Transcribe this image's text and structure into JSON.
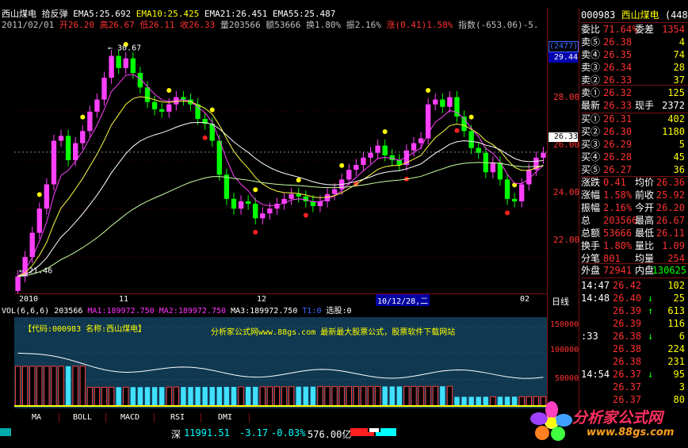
{
  "header": {
    "stock_name": "西山煤电",
    "indicator": "拾反弹",
    "ema5": "EMA5:25.692",
    "ema10": "EMA10:25.425",
    "ema21": "EMA21:26.451",
    "ema55": "EMA55:25.487",
    "date": "2011/02/01",
    "open": "开26.20",
    "high": "高26.67",
    "low": "低26.11",
    "close": "收26.33",
    "volume": "量203566",
    "amount": "额53666",
    "turnover": "换1.80%",
    "amplitude": "振2.16%",
    "change": "涨(0.41)1.58%",
    "index": "指数(-653.06)-5."
  },
  "chart_labels": {
    "high_mark": "30.67",
    "low_mark": "21.46",
    "count_box": "(2477)",
    "top_price": "29.44",
    "y_ticks": [
      "28.00",
      "26.00",
      "24.00",
      "22.00"
    ],
    "current_price": "26.33",
    "x_labels": [
      "2010",
      "11",
      "12",
      "10/12/28,二",
      "02"
    ],
    "period": "日线"
  },
  "volume_header": {
    "vol": "VOL(6,6,6)",
    "vol_value": "203566",
    "ma1": "MA1:189972.750",
    "ma2": "MA2:189972.750",
    "ma3": "MA3:189972.750",
    "t1": "T1:0",
    "select": "选股:0",
    "code_line": "【代码:000983 名称:西山煤电】",
    "ad_line": "分析家公式网www.88gs.com 最新最大股票公式，股票软件下载网站",
    "y_ticks": [
      "150000",
      "100000",
      "50000"
    ]
  },
  "tabs": [
    "MA",
    "BOLL",
    "MACD",
    "RSI",
    "DMI"
  ],
  "status_bar": {
    "market": "深",
    "index_value": "11991.51",
    "change": "-3.17",
    "pct": "-0.03%",
    "amount": "576.00亿"
  },
  "right_panel": {
    "code": "000983",
    "name": "西山煤电",
    "extra": "(448",
    "weibi_label": "委比",
    "weibi": "71.64%",
    "weicha_label": "委差",
    "weicha": "1354",
    "asks": [
      {
        "label": "卖⑤",
        "price": "26.38",
        "vol": "4"
      },
      {
        "label": "卖④",
        "price": "26.35",
        "vol": "74"
      },
      {
        "label": "卖③",
        "price": "26.34",
        "vol": "28"
      },
      {
        "label": "卖②",
        "price": "26.33",
        "vol": "37"
      },
      {
        "label": "卖①",
        "price": "26.32",
        "vol": "125"
      }
    ],
    "last_label": "最新",
    "last": "26.33",
    "hand_label": "现手",
    "hand": "2372",
    "bids": [
      {
        "label": "买①",
        "price": "26.31",
        "vol": "402"
      },
      {
        "label": "买②",
        "price": "26.30",
        "vol": "1180"
      },
      {
        "label": "买③",
        "price": "26.29",
        "vol": "5"
      },
      {
        "label": "买④",
        "price": "26.28",
        "vol": "45"
      },
      {
        "label": "买⑤",
        "price": "26.27",
        "vol": "36"
      }
    ],
    "stats": [
      {
        "l1": "涨跌",
        "v1": "0.41",
        "l2": "均价",
        "v2": "26.36"
      },
      {
        "l1": "涨幅",
        "v1": "1.58%",
        "l2": "前收",
        "v2": "25.92"
      },
      {
        "l1": "振幅",
        "v1": "2.16%",
        "l2": "今开",
        "v2": "26.20"
      },
      {
        "l1": "总",
        "v1": "203566",
        "l2": "最高",
        "v2": "26.67"
      },
      {
        "l1": "总额",
        "v1": "53666",
        "l2": "最低",
        "v2": "26.11"
      },
      {
        "l1": "换手",
        "v1": "1.80%",
        "l2": "量比",
        "v2": "1.09"
      },
      {
        "l1": "分笔",
        "v1": "801",
        "l2": "均量",
        "v2": "254"
      }
    ],
    "outer_label": "外盘",
    "outer": "72941",
    "inner_label": "内盘",
    "inner": "130625",
    "ticks": [
      {
        "time": "14:47",
        "price": "26.42",
        "arrow": "",
        "vol": "102"
      },
      {
        "time": "14:48",
        "price": "26.40",
        "arrow": "↓",
        "vol": "25"
      },
      {
        "time": "",
        "price": "26.39",
        "arrow": "↑",
        "vol": "613"
      },
      {
        "time": "",
        "price": "26.39",
        "arrow": "",
        "vol": "116"
      },
      {
        "time": ":33",
        "price": "26.38",
        "arrow": "↓",
        "vol": "6"
      },
      {
        "time": "",
        "price": "26.38",
        "arrow": "",
        "vol": "224"
      },
      {
        "time": "",
        "price": "26.38",
        "arrow": "",
        "vol": "231"
      },
      {
        "time": "14:54",
        "price": "26.37",
        "arrow": "↓",
        "vol": "95"
      },
      {
        "time": "",
        "price": "26.37",
        "arrow": "",
        "vol": "3"
      },
      {
        "time": "",
        "price": "26.37",
        "arrow": "",
        "vol": "80"
      }
    ],
    "watermark": "分析家公式网",
    "watermark_url": "www.88gs.com"
  }
}
